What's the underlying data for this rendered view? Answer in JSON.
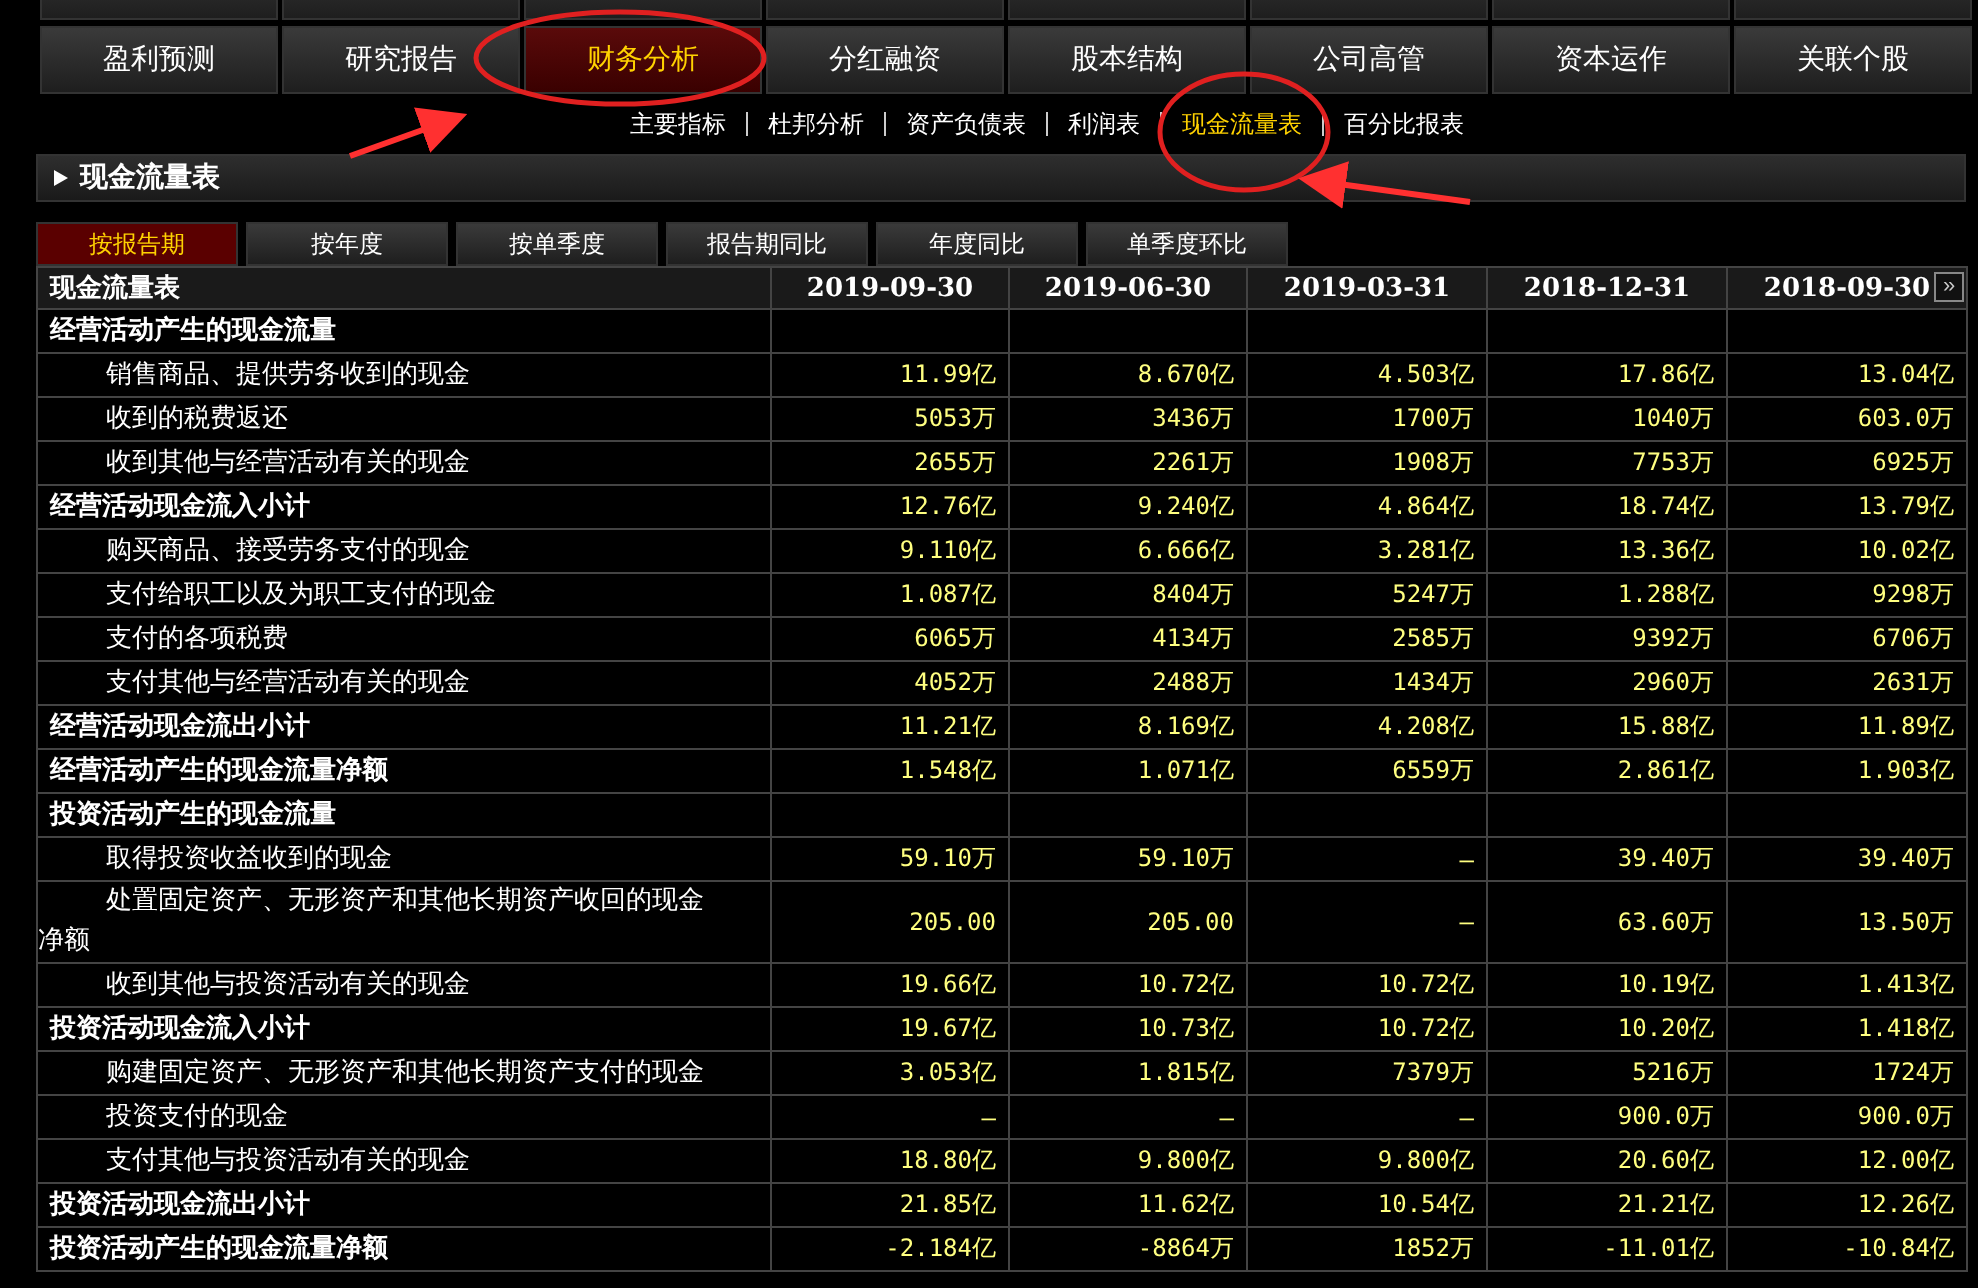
{
  "nav": [
    {
      "label": "盈利预测",
      "selected": false
    },
    {
      "label": "研究报告",
      "selected": false
    },
    {
      "label": "财务分析",
      "selected": true
    },
    {
      "label": "分红融资",
      "selected": false
    },
    {
      "label": "股本结构",
      "selected": false
    },
    {
      "label": "公司高管",
      "selected": false
    },
    {
      "label": "资本运作",
      "selected": false
    },
    {
      "label": "关联个股",
      "selected": false
    }
  ],
  "subnav": [
    {
      "label": "主要指标",
      "selected": false
    },
    {
      "label": "杜邦分析",
      "selected": false
    },
    {
      "label": "资产负债表",
      "selected": false
    },
    {
      "label": "利润表",
      "selected": false
    },
    {
      "label": "现金流量表",
      "selected": true
    },
    {
      "label": "百分比报表",
      "selected": false
    }
  ],
  "section": {
    "title": "现金流量表"
  },
  "tabs": [
    {
      "label": "按报告期",
      "selected": true
    },
    {
      "label": "按年度",
      "selected": false
    },
    {
      "label": "按单季度",
      "selected": false
    },
    {
      "label": "报告期同比",
      "selected": false
    },
    {
      "label": "年度同比",
      "selected": false
    },
    {
      "label": "单季度环比",
      "selected": false
    }
  ],
  "table": {
    "columns": [
      "现金流量表",
      "2019-09-30",
      "2019-06-30",
      "2019-03-31",
      "2018-12-31",
      "2018-09-30"
    ],
    "more": "»",
    "rows": [
      {
        "kind": "section",
        "label": "经营活动产生的现金流量",
        "values": []
      },
      {
        "kind": "item",
        "label": "销售商品、提供劳务收到的现金",
        "values": [
          "11.99亿",
          "8.670亿",
          "4.503亿",
          "17.86亿",
          "13.04亿"
        ]
      },
      {
        "kind": "item",
        "label": "收到的税费返还",
        "values": [
          "5053万",
          "3436万",
          "1700万",
          "1040万",
          "603.0万"
        ]
      },
      {
        "kind": "item",
        "label": "收到其他与经营活动有关的现金",
        "values": [
          "2655万",
          "2261万",
          "1908万",
          "7753万",
          "6925万"
        ]
      },
      {
        "kind": "section",
        "label": "经营活动现金流入小计",
        "values": [
          "12.76亿",
          "9.240亿",
          "4.864亿",
          "18.74亿",
          "13.79亿"
        ]
      },
      {
        "kind": "item",
        "label": "购买商品、接受劳务支付的现金",
        "values": [
          "9.110亿",
          "6.666亿",
          "3.281亿",
          "13.36亿",
          "10.02亿"
        ]
      },
      {
        "kind": "item",
        "label": "支付给职工以及为职工支付的现金",
        "values": [
          "1.087亿",
          "8404万",
          "5247万",
          "1.288亿",
          "9298万"
        ]
      },
      {
        "kind": "item",
        "label": "支付的各项税费",
        "values": [
          "6065万",
          "4134万",
          "2585万",
          "9392万",
          "6706万"
        ]
      },
      {
        "kind": "item",
        "label": "支付其他与经营活动有关的现金",
        "values": [
          "4052万",
          "2488万",
          "1434万",
          "2960万",
          "2631万"
        ]
      },
      {
        "kind": "section",
        "label": "经营活动现金流出小计",
        "values": [
          "11.21亿",
          "8.169亿",
          "4.208亿",
          "15.88亿",
          "11.89亿"
        ]
      },
      {
        "kind": "section",
        "label": "经营活动产生的现金流量净额",
        "values": [
          "1.548亿",
          "1.071亿",
          "6559万",
          "2.861亿",
          "1.903亿"
        ]
      },
      {
        "kind": "section",
        "label": "投资活动产生的现金流量",
        "values": []
      },
      {
        "kind": "item",
        "label": "取得投资收益收到的现金",
        "values": [
          "59.10万",
          "59.10万",
          "—",
          "39.40万",
          "39.40万"
        ]
      },
      {
        "kind": "item",
        "label": "处置固定资产、无形资产和其他长期资产收回的现金净额",
        "values": [
          "205.00",
          "205.00",
          "—",
          "63.60万",
          "13.50万"
        ]
      },
      {
        "kind": "item",
        "label": "收到其他与投资活动有关的现金",
        "values": [
          "19.66亿",
          "10.72亿",
          "10.72亿",
          "10.19亿",
          "1.413亿"
        ]
      },
      {
        "kind": "section",
        "label": "投资活动现金流入小计",
        "values": [
          "19.67亿",
          "10.73亿",
          "10.72亿",
          "10.20亿",
          "1.418亿"
        ]
      },
      {
        "kind": "item",
        "label": "购建固定资产、无形资产和其他长期资产支付的现金",
        "values": [
          "3.053亿",
          "1.815亿",
          "7379万",
          "5216万",
          "1724万"
        ]
      },
      {
        "kind": "item",
        "label": "投资支付的现金",
        "values": [
          "—",
          "—",
          "—",
          "900.0万",
          "900.0万"
        ]
      },
      {
        "kind": "item",
        "label": "支付其他与投资活动有关的现金",
        "values": [
          "18.80亿",
          "9.800亿",
          "9.800亿",
          "20.60亿",
          "12.00亿"
        ]
      },
      {
        "kind": "section",
        "label": "投资活动现金流出小计",
        "values": [
          "21.85亿",
          "11.62亿",
          "10.54亿",
          "21.21亿",
          "12.26亿"
        ]
      },
      {
        "kind": "section",
        "label": "投资活动产生的现金流量净额",
        "values": [
          "-2.184亿",
          "-8864万",
          "1852万",
          "-11.01亿",
          "-10.84亿"
        ]
      }
    ]
  }
}
